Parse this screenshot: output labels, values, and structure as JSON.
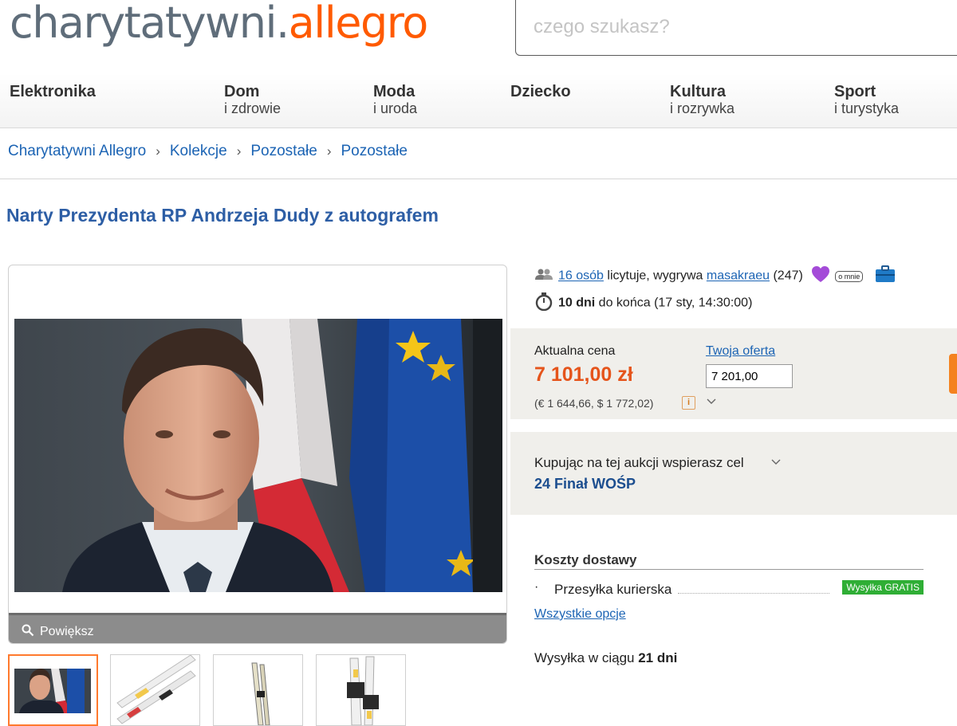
{
  "header": {
    "logo_part1": "charytatywni.",
    "logo_part2": "allegro",
    "search_placeholder": "czego szukasz?"
  },
  "nav": [
    {
      "line1": "Elektronika",
      "line2": ""
    },
    {
      "line1": "Dom",
      "line2": "i zdrowie"
    },
    {
      "line1": "Moda",
      "line2": "i uroda"
    },
    {
      "line1": "Dziecko",
      "line2": ""
    },
    {
      "line1": "Kultura",
      "line2": "i rozrywka"
    },
    {
      "line1": "Sport",
      "line2": "i turystyka"
    }
  ],
  "breadcrumb": [
    "Charytatywni Allegro",
    "Kolekcje",
    "Pozostałe",
    "Pozostałe"
  ],
  "breadcrumb_sep": "›",
  "title": "Narty Prezydenta RP Andrzeja Dudy z autografem",
  "gallery": {
    "zoom_label": "Powiększ"
  },
  "auction": {
    "bidders_link": "16 osób",
    "bidders_text": " licytuje, wygrywa ",
    "winner": "masakraeu",
    "winner_score": " (247)",
    "about_label": "o mnie",
    "time_left": "10 dni",
    "time_text": " do końca (17 sty, 14:30:00)"
  },
  "price": {
    "label": "Aktualna cena",
    "value": "7 101,00 zł",
    "conversion": "(€ 1 644,66, $ 1 772,02)",
    "offer_label": "Twoja oferta",
    "offer_value": "7 201,00"
  },
  "charity": {
    "text": "Kupując na tej aukcji wspierasz cel",
    "cause": "24 Finał WOŚP"
  },
  "shipping": {
    "title": "Koszty dostawy",
    "method": "Przesyłka kurierska",
    "badge": "Wysyłka GRATIS",
    "all_options": "Wszystkie opcje",
    "delivery_prefix": "Wysyłka w ciągu ",
    "delivery_days": "21 dni"
  },
  "colors": {
    "accent": "#ff5a00",
    "link": "#1c64b4",
    "price": "#e5541b",
    "badge": "#2fae35"
  }
}
